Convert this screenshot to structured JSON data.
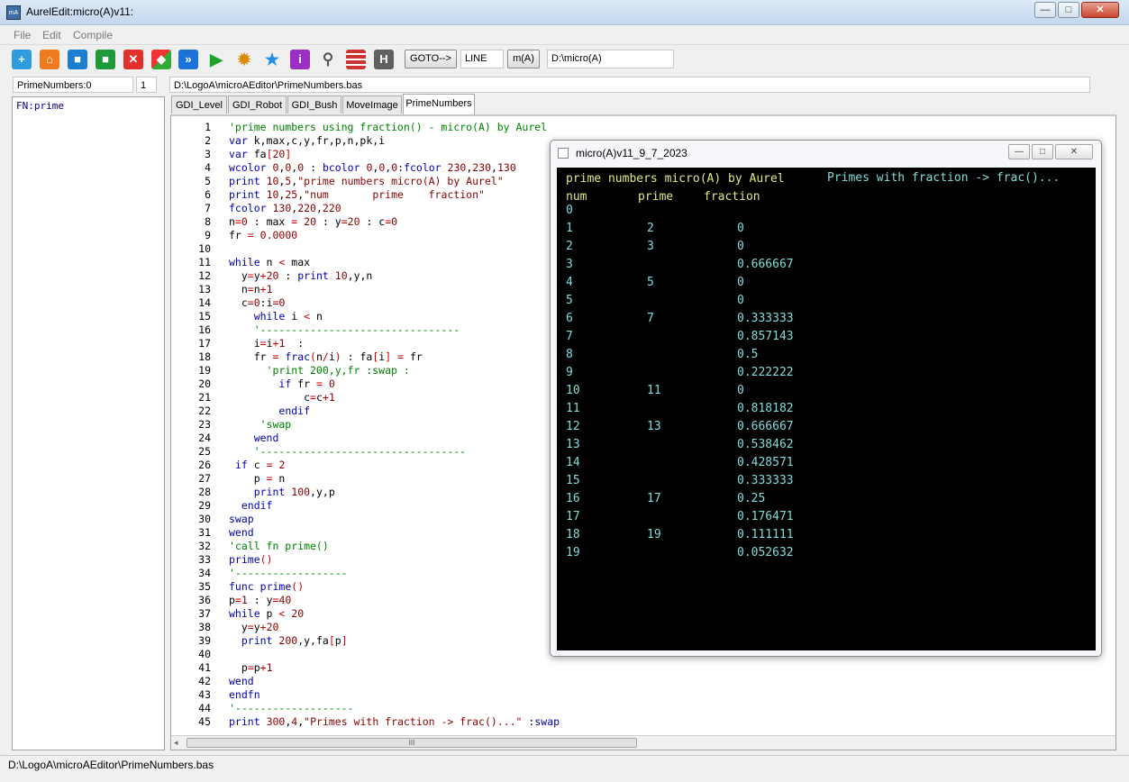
{
  "window": {
    "title": "AurelEdit:micro(A)v11:",
    "minimize": "—",
    "maximize": "□",
    "close": "✕"
  },
  "menu": [
    "File",
    "Edit",
    "Compile"
  ],
  "toolbar": {
    "goto_label": "GOTO-->",
    "line_value": "LINE",
    "mode_label": "m(A)",
    "path_value": "D:\\micro(A)"
  },
  "funcs_field": "PrimeNumbers:0",
  "count_field": "1",
  "file_path": "D:\\LogoA\\microAEditor\\PrimeNumbers.bas",
  "fn_list": [
    "FN:prime"
  ],
  "tabs": [
    "GDI_Level",
    "GDI_Robot",
    "GDI_Bush",
    "MoveImage",
    "PrimeNumbers"
  ],
  "active_tab": "PrimeNumbers",
  "code_lines": [
    "'prime numbers using fraction() - micro(A) by Aurel",
    "var k,max,c,y,fr,p,n,pk,i",
    "var fa[20]",
    "wcolor 0,0,0 : bcolor 0,0,0:fcolor 230,230,130",
    "print 10,5,\"prime numbers micro(A) by Aurel\"",
    "print 10,25,\"num       prime    fraction\"",
    "fcolor 130,220,220",
    "n=0 : max = 20 : y=20 : c=0",
    "fr = 0.0000",
    "",
    "while n < max",
    "  y=y+20 : print 10,y,n",
    "  n=n+1",
    "  c=0:i=0",
    "    while i < n",
    "    '--------------------------------",
    "    i=i+1  :",
    "    fr = frac(n/i) : fa[i] = fr",
    "      'print 200,y,fr :swap :",
    "        if fr = 0",
    "            c=c+1",
    "        endif",
    "     'swap",
    "    wend",
    "    '---------------------------------",
    " if c = 2",
    "    p = n",
    "    print 100,y,p",
    "  endif",
    "swap",
    "wend",
    "'call fn prime()",
    "prime()",
    "'------------------",
    "func prime()",
    "p=1 : y=40",
    "while p < 20",
    "  y=y+20",
    "  print 200,y,fa[p]",
    "",
    "  p=p+1",
    "wend",
    "endfn",
    "'-------------------",
    "print 300,4,\"Primes with fraction -> frac()...\" :swap"
  ],
  "statusbar": "D:\\LogoA\\microAEditor\\PrimeNumbers.bas",
  "output_window": {
    "title": "micro(A)v11_9_7_2023",
    "header_left": "prime numbers micro(A) by Aurel",
    "header_right": "Primes with fraction -> frac()...",
    "col_num": "num",
    "col_prime": "prime",
    "col_fraction": "fraction",
    "rows": [
      {
        "num": "0",
        "prime": "",
        "frac": ""
      },
      {
        "num": "1",
        "prime": "2",
        "frac": "0"
      },
      {
        "num": "2",
        "prime": "3",
        "frac": "0"
      },
      {
        "num": "3",
        "prime": "",
        "frac": "0.666667"
      },
      {
        "num": "4",
        "prime": "5",
        "frac": "0"
      },
      {
        "num": "5",
        "prime": "",
        "frac": "0"
      },
      {
        "num": "6",
        "prime": "7",
        "frac": "0.333333"
      },
      {
        "num": "7",
        "prime": "",
        "frac": "0.857143"
      },
      {
        "num": "8",
        "prime": "",
        "frac": "0.5"
      },
      {
        "num": "9",
        "prime": "",
        "frac": "0.222222"
      },
      {
        "num": "10",
        "prime": "11",
        "frac": "0"
      },
      {
        "num": "11",
        "prime": "",
        "frac": "0.818182"
      },
      {
        "num": "12",
        "prime": "13",
        "frac": "0.666667"
      },
      {
        "num": "13",
        "prime": "",
        "frac": "0.538462"
      },
      {
        "num": "14",
        "prime": "",
        "frac": "0.428571"
      },
      {
        "num": "15",
        "prime": "",
        "frac": "0.333333"
      },
      {
        "num": "16",
        "prime": "17",
        "frac": "0.25"
      },
      {
        "num": "17",
        "prime": "",
        "frac": "0.176471"
      },
      {
        "num": "18",
        "prime": "19",
        "frac": "0.111111"
      },
      {
        "num": "19",
        "prime": "",
        "frac": "0.052632"
      }
    ],
    "colors": {
      "header": "#e6e682",
      "body": "#82dcdc",
      "background": "#000000"
    }
  }
}
